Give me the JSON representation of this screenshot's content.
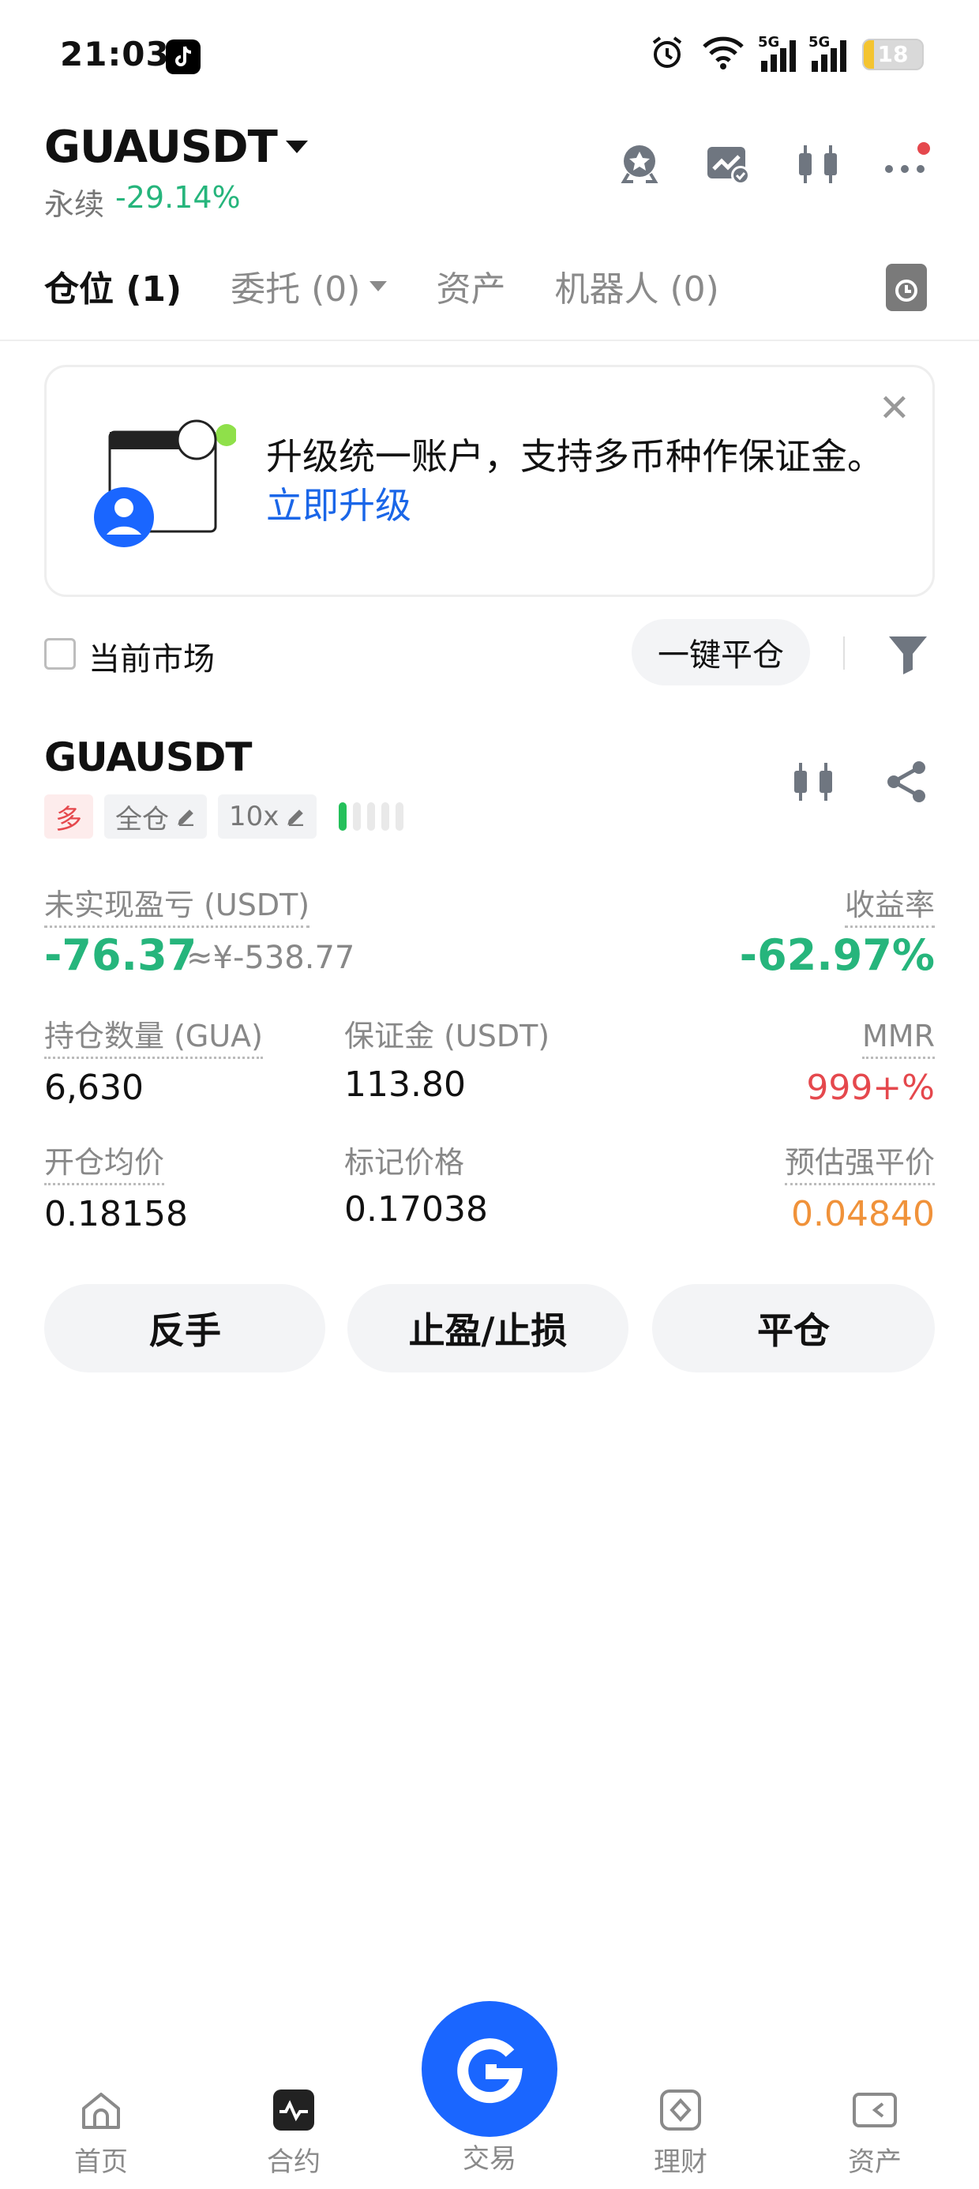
{
  "status_bar": {
    "time": "21:03",
    "signal1_label": "5G",
    "signal2_label": "5G",
    "battery_level": "18",
    "battery_fraction": 0.18
  },
  "header": {
    "symbol": "GUAUSDT",
    "contract_type": "永续",
    "change_pct": "-29.14%",
    "icons": [
      "badge-icon",
      "chart-check-icon",
      "candlestick-icon",
      "more-icon"
    ]
  },
  "tabs": [
    {
      "label": "仓位 (1)",
      "active": true
    },
    {
      "label": "委托 (0)",
      "active": false,
      "has_dropdown": true
    },
    {
      "label": "资产",
      "active": false
    },
    {
      "label": "机器人 (0)",
      "active": false
    }
  ],
  "banner": {
    "text": "升级统一账户，支持多币种作保证金。",
    "link": "立即升级"
  },
  "filter": {
    "current_market_label": "当前市场",
    "close_all_label": "一键平仓"
  },
  "position": {
    "symbol": "GUAUSDT",
    "side": "多",
    "margin_mode": "全仓",
    "leverage": "10x",
    "strength_level": 1,
    "strength_total": 5,
    "unrealized_pnl_label": "未实现盈亏 (USDT)",
    "unrealized_pnl": "-76.37",
    "unrealized_pnl_cny": "≈¥-538.77",
    "roi_label": "收益率",
    "roi": "-62.97%",
    "size_label": "持仓数量 (GUA)",
    "size": "6,630",
    "margin_label": "保证金 (USDT)",
    "margin": "113.80",
    "mmr_label": "MMR",
    "mmr": "999+%",
    "entry_label": "开仓均价",
    "entry": "0.18158",
    "mark_label": "标记价格",
    "mark": "0.17038",
    "liq_label": "预估强平价",
    "liq": "0.04840",
    "buttons": {
      "reverse": "反手",
      "tpsl": "止盈/止损",
      "close": "平仓"
    }
  },
  "bottom_nav": [
    {
      "label": "首页",
      "icon": "home-icon"
    },
    {
      "label": "合约",
      "icon": "futures-icon",
      "active": true
    },
    {
      "label": "交易",
      "icon": "trade-icon"
    },
    {
      "label": "理财",
      "icon": "earn-icon"
    },
    {
      "label": "资产",
      "icon": "wallet-icon"
    }
  ],
  "colors": {
    "up_green": "#26b57c",
    "down_red": "#e5484d",
    "warn_orange": "#f0923a",
    "link_blue": "#1a66e8",
    "brand_blue": "#1a66ff"
  }
}
